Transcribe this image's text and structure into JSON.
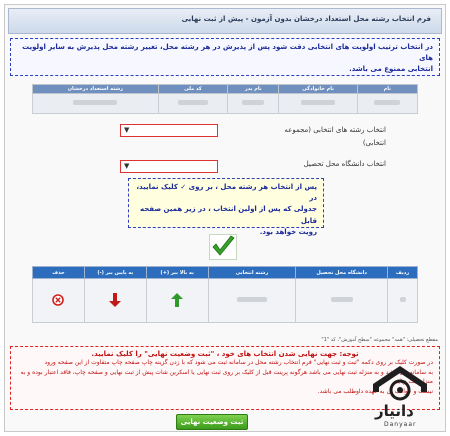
{
  "header": {
    "title": "فرم انتخاب رشته محل استعداد درخشان بدون آزمون - پیش از ثبت نهایی"
  },
  "notice_top": {
    "line1": "در انتخاب ترتیب اولویت های انتخابی دقت شود پس از پذیرش در هر رشته محل، تغییر رشته محل پذیرش به سایر اولویت های",
    "line2": "انتخابی ممنوع می باشد."
  },
  "applicant_table": {
    "headers": [
      "نام",
      "نام خانوادگی",
      "نام پدر",
      "کد ملی",
      "رشته استعداد درخشان"
    ]
  },
  "form": {
    "field_label_line1": "انتخاب رشته های انتخابی (مجموعه",
    "field_label_line2": "انتخابی)",
    "university_label": "انتخاب دانشگاه محل تحصیل"
  },
  "instructions": {
    "line1": "پس از انتخاب هر رشته محل ، بر روی ✓ کلیک نمایید، در",
    "line2": "جدولی که پس از اولین انتخاب ، در زیر همین صفحه قابل",
    "line3": "رویت خواهد بود."
  },
  "selection_table": {
    "headers": [
      "ردیف",
      "دانشگاه محل تحصیل",
      "رشته انتخابی",
      "به بالا ببر (+)",
      "به پایین ببر (-)",
      "حذف"
    ]
  },
  "footnote": "مقطع تحصیلی: \"همه\" مجموعه \"سطح آموزش\"، کد \"1\"",
  "final_notice": {
    "title": "توجه: جهت نهایی شدن انتخاب های خود ، \"ثبت وضعیت نهایی\" را کلیک نمایید.",
    "line1": "در صورت کلیک بر روی دکمه \"ثبت و ثبت نهایی\" فرم انتخاب رشته محل در سامانه ثبت می شود که با زدن گزینه چاپ صفحه چاپ متفاوت از این صفحه ورود",
    "line2": "به سامانه می باشد و به منزله ثبت نهایی می باشد هرگونه پرینت قبل از کلیک بر روی ثبت نهایی یا اسکرین شات پیش از ثبت نهایی و صفحه چاپ، فاقد اعتبار بوده و به منزله ثبت نهایی",
    "line3": "نیست و عواقب آن به عهده داوطلب می باشد."
  },
  "buttons": {
    "final_submit": "ثبت وضعیت نهایی"
  },
  "watermark": {
    "word": "دانیار",
    "sub": "Danyaar"
  },
  "colors": {
    "accent_blue": "#2d6dbd",
    "notice_blue": "#1b2a9a",
    "alert_red": "#c01010",
    "success_green": "#3c9a1c"
  }
}
